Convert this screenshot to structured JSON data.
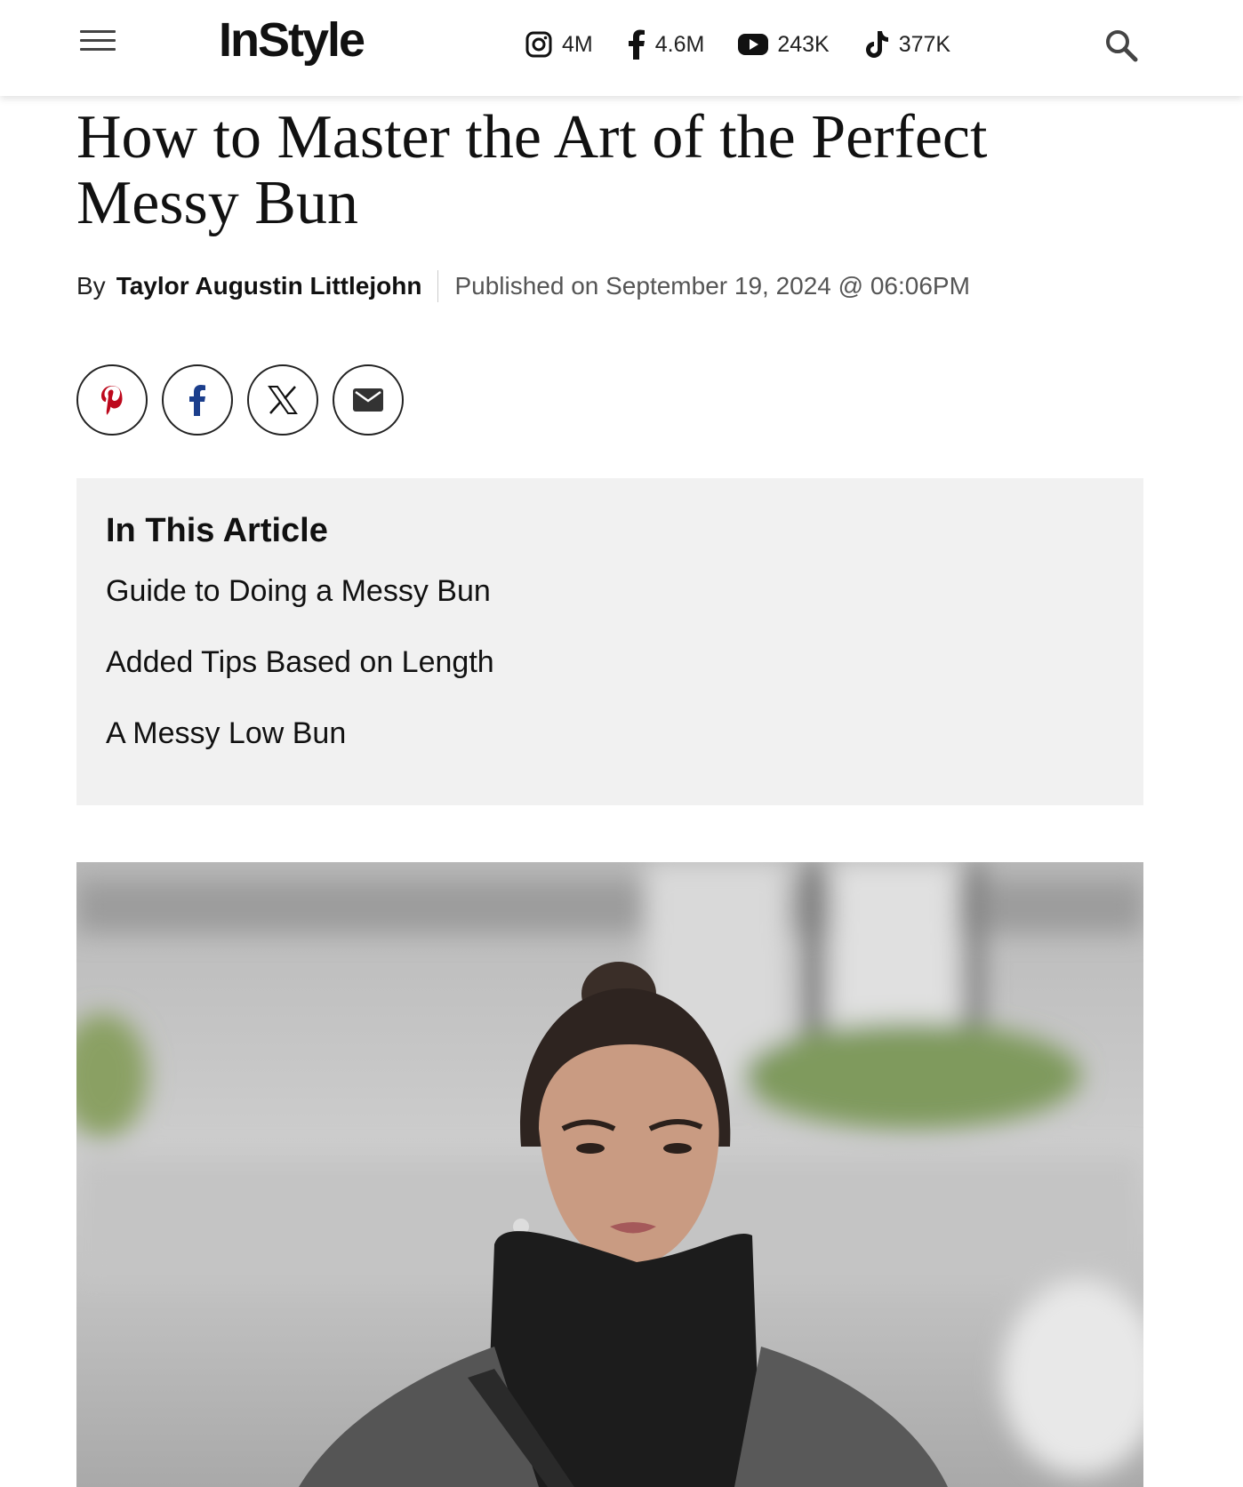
{
  "header": {
    "logo": "InStyle",
    "socials": [
      {
        "icon": "instagram-icon",
        "count": "4M"
      },
      {
        "icon": "facebook-icon",
        "count": "4.6M"
      },
      {
        "icon": "youtube-icon",
        "count": "243K"
      },
      {
        "icon": "tiktok-icon",
        "count": "377K"
      }
    ]
  },
  "article": {
    "title": "How to Master the Art of the Perfect Messy Bun",
    "by_label": "By",
    "author": "Taylor Augustin Littlejohn",
    "published": "Published on September 19, 2024 @ 06:06PM"
  },
  "share": {
    "buttons": [
      "pinterest-icon",
      "facebook-icon",
      "x-icon",
      "email-icon"
    ],
    "colors": {
      "pinterest": "#bd081c",
      "facebook": "#1b3e8c"
    }
  },
  "toc": {
    "title": "In This Article",
    "items": [
      "Guide to Doing a Messy Bun",
      "Added Tips Based on Length",
      "A Messy Low Bun"
    ],
    "background": "#f1f1f1"
  }
}
